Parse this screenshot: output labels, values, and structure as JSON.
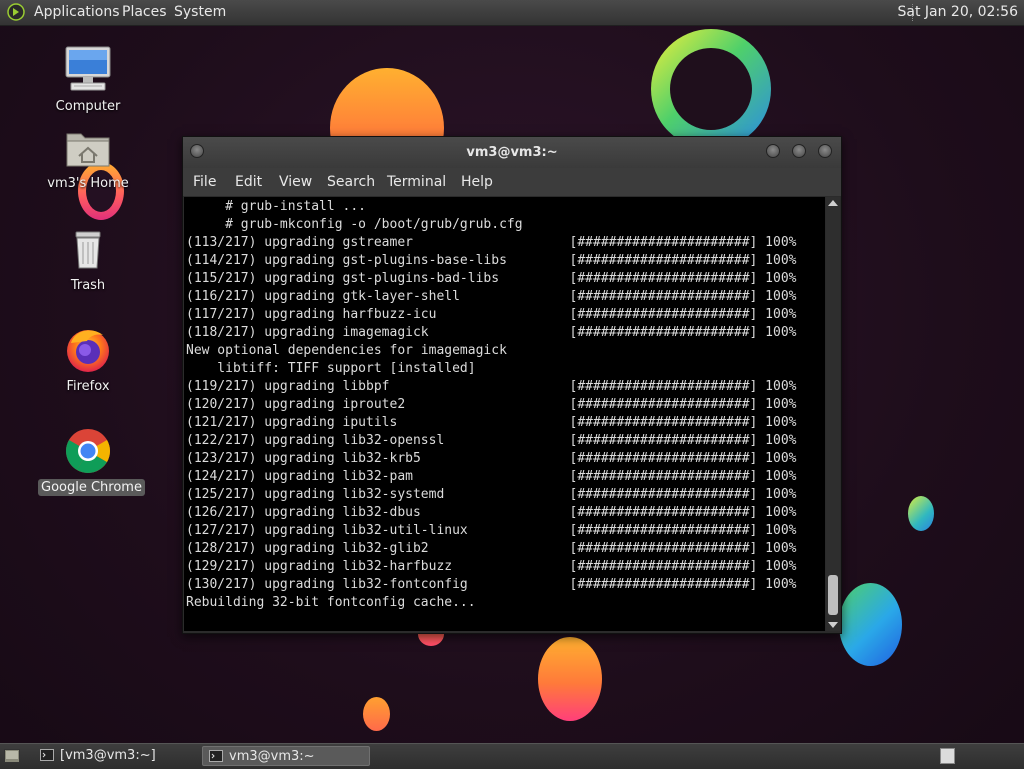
{
  "top_panel": {
    "menus": [
      "Applications",
      "Places",
      "System"
    ],
    "clock": "Sat Jan 20, 02:56"
  },
  "desktop_icons": [
    {
      "label": "Computer",
      "icon": "computer-icon"
    },
    {
      "label": "vm3's Home",
      "icon": "home-folder-icon"
    },
    {
      "label": "Trash",
      "icon": "trash-icon"
    },
    {
      "label": "Firefox",
      "icon": "firefox-icon"
    },
    {
      "label": "Google Chrome",
      "icon": "chrome-icon",
      "selected": true
    }
  ],
  "terminal": {
    "title": "vm3@vm3:~",
    "menus": [
      "File",
      "Edit",
      "View",
      "Search",
      "Terminal",
      "Help"
    ],
    "lines": [
      "     # grub-install ...",
      "     # grub-mkconfig -o /boot/grub/grub.cfg",
      "(113/217) upgrading gstreamer                    [######################] 100%",
      "(114/217) upgrading gst-plugins-base-libs        [######################] 100%",
      "(115/217) upgrading gst-plugins-bad-libs         [######################] 100%",
      "(116/217) upgrading gtk-layer-shell              [######################] 100%",
      "(117/217) upgrading harfbuzz-icu                 [######################] 100%",
      "(118/217) upgrading imagemagick                  [######################] 100%",
      "New optional dependencies for imagemagick",
      "    libtiff: TIFF support [installed]",
      "(119/217) upgrading libbpf                       [######################] 100%",
      "(120/217) upgrading iproute2                     [######################] 100%",
      "(121/217) upgrading iputils                      [######################] 100%",
      "(122/217) upgrading lib32-openssl                [######################] 100%",
      "(123/217) upgrading lib32-krb5                   [######################] 100%",
      "(124/217) upgrading lib32-pam                    [######################] 100%",
      "(125/217) upgrading lib32-systemd                [######################] 100%",
      "(126/217) upgrading lib32-dbus                   [######################] 100%",
      "(127/217) upgrading lib32-util-linux             [######################] 100%",
      "(128/217) upgrading lib32-glib2                  [######################] 100%",
      "(129/217) upgrading lib32-harfbuzz               [######################] 100%",
      "(130/217) upgrading lib32-fontconfig             [######################] 100%",
      "Rebuilding 32-bit fontconfig cache..."
    ]
  },
  "taskbar": {
    "tasks": [
      {
        "label": "[vm3@vm3:~]",
        "active": false
      },
      {
        "label": "vm3@vm3:~",
        "active": true
      }
    ]
  },
  "colors": {
    "panel": "#3a3a3a",
    "desktop_bg": "#1f0f1c",
    "terminal_bg": "#000000",
    "terminal_fg": "#dcdcdc"
  }
}
